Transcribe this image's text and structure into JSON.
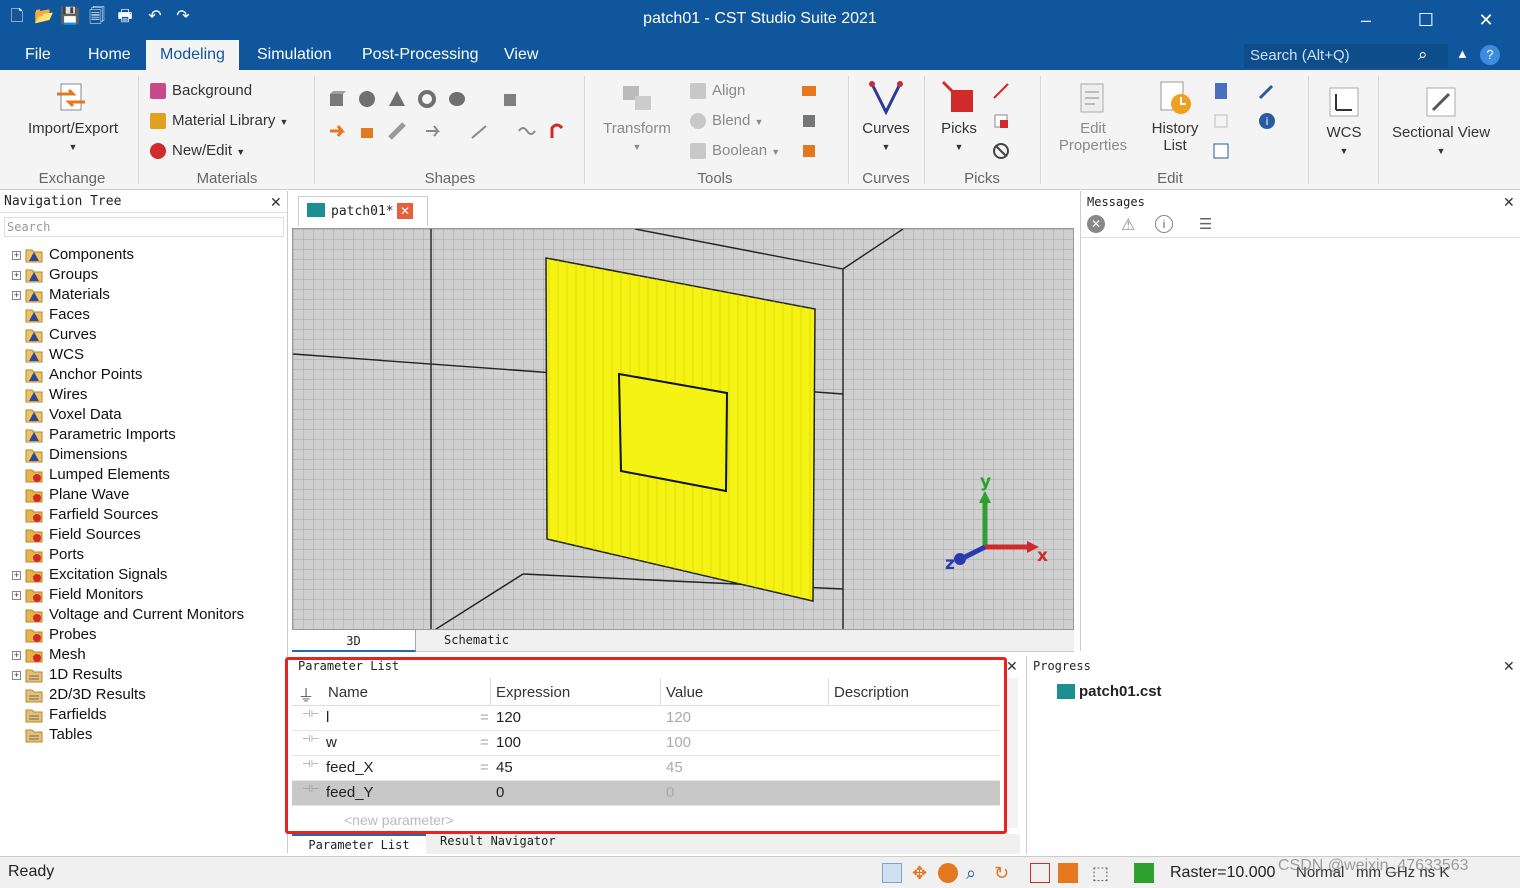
{
  "window": {
    "title": "patch01 - CST Studio Suite 2021"
  },
  "menu": {
    "items": [
      "File",
      "Home",
      "Modeling",
      "Simulation",
      "Post-Processing",
      "View"
    ],
    "active": "Modeling"
  },
  "search": {
    "placeholder": "Search (Alt+Q)"
  },
  "ribbon": {
    "exchange": {
      "button": "Import/Export",
      "group": "Exchange"
    },
    "materials": {
      "background": "Background",
      "library": "Material Library",
      "newedit": "New/Edit",
      "group": "Materials"
    },
    "shapes": {
      "group": "Shapes"
    },
    "tools": {
      "transform": "Transform",
      "align": "Align",
      "blend": "Blend",
      "boolean": "Boolean",
      "group": "Tools"
    },
    "curves": {
      "button": "Curves",
      "group": "Curves"
    },
    "picks": {
      "button": "Picks",
      "group": "Picks"
    },
    "edit": {
      "properties": "Edit Properties",
      "history": "History List",
      "group": "Edit"
    },
    "wcs": {
      "button": "WCS"
    },
    "sectional": {
      "button": "Sectional View"
    }
  },
  "nav": {
    "title": "Navigation Tree",
    "search": "Search",
    "items": [
      "Components",
      "Groups",
      "Materials",
      "Faces",
      "Curves",
      "WCS",
      "Anchor Points",
      "Wires",
      "Voxel Data",
      "Parametric Imports",
      "Dimensions",
      "Lumped Elements",
      "Plane Wave",
      "Farfield Sources",
      "Field Sources",
      "Ports",
      "Excitation Signals",
      "Field Monitors",
      "Voltage and Current Monitors",
      "Probes",
      "Mesh",
      "1D Results",
      "2D/3D Results",
      "Farfields",
      "Tables"
    ]
  },
  "doc_tab": {
    "label": "patch01*"
  },
  "view_tabs": {
    "tab3d": "3D",
    "schematic": "Schematic"
  },
  "axes": {
    "x": "x",
    "y": "y",
    "z": "z"
  },
  "params": {
    "title": "Parameter List",
    "columns": [
      "Name",
      "Expression",
      "Value",
      "Description"
    ],
    "rows": [
      {
        "name": "l",
        "expr": "120",
        "value": "120"
      },
      {
        "name": "w",
        "expr": "100",
        "value": "100"
      },
      {
        "name": "feed_X",
        "expr": "45",
        "value": "45"
      },
      {
        "name": "feed_Y",
        "expr": "0",
        "value": "0"
      }
    ],
    "new_param": "<new parameter>",
    "tabs": [
      "Parameter List",
      "Result Navigator"
    ]
  },
  "messages": {
    "title": "Messages"
  },
  "progress": {
    "title": "Progress",
    "file": "patch01.cst"
  },
  "status": {
    "text": "Ready",
    "raster": "Raster=10.000",
    "units": "Normal",
    "extra": "mm  GHz  ns  K",
    "watermark": "CSDN @weixin_47633563"
  },
  "colors": {
    "title_bar": "#10569c",
    "patch_yellow": "#f5f314",
    "highlight_red": "#e8241f"
  }
}
